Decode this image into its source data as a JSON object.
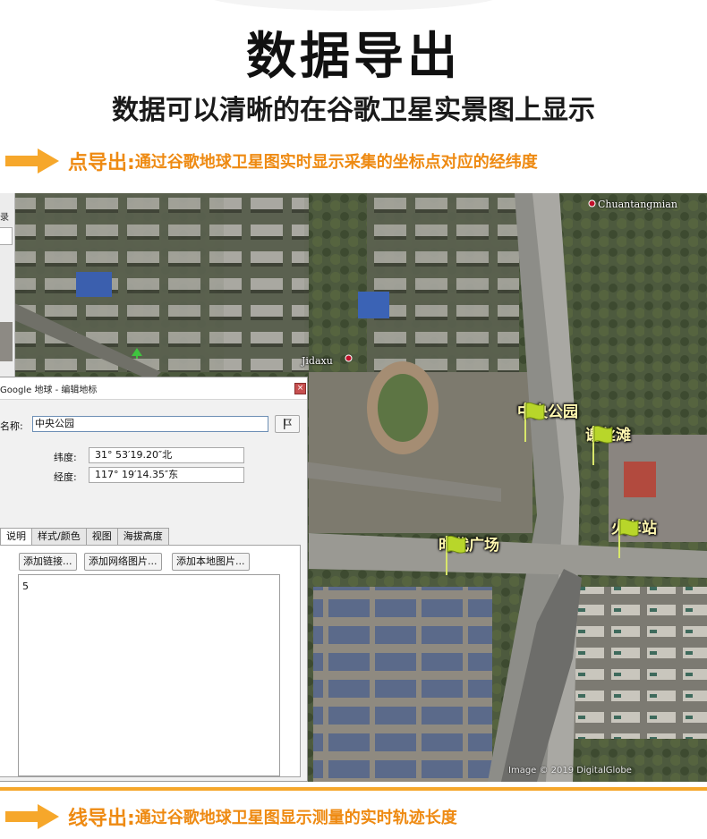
{
  "header": {
    "title": "数据导出",
    "subtitle": "数据可以清晰的在谷歌卫星实景图上显示"
  },
  "features": {
    "point": {
      "label": "点导出:",
      "description": "通过谷歌地球卫星图实时显示采集的坐标点对应的经纬度"
    },
    "line": {
      "label": "线导出:",
      "description": "通过谷歌地球卫星图显示测量的实时轨迹长度"
    }
  },
  "map": {
    "labels": {
      "chuantangmian": "Chuantangmian",
      "jidaxu": "Jidaxu"
    },
    "placemarks": [
      "中央公园",
      "谢丝滩",
      "时代广场",
      "火车站"
    ],
    "copyright": "Image © 2019 DigitalGlobe"
  },
  "left_panel": {
    "text": "录"
  },
  "dialog": {
    "title": "Google 地球 - 编辑地标",
    "close_label": "×",
    "name_label": "名称:",
    "name_value": "中央公园",
    "latitude_label": "纬度:",
    "latitude_value": "31° 53′19.20″北",
    "longitude_label": "经度:",
    "longitude_value": "117° 19′14.35″东",
    "tabs": [
      "说明",
      "样式/颜色",
      "视图",
      "海拔高度"
    ],
    "buttons": [
      "添加链接...",
      "添加网络图片...",
      "添加本地图片..."
    ],
    "description_text": "5"
  },
  "colors": {
    "accent_orange": "#ee8a12",
    "arrow_orange": "#f6a72b",
    "placemark_flag": "#b8d62a"
  },
  "icons": [
    "arrow-right-icon",
    "placemark-flag-icon",
    "placemark-pin-icon",
    "close-icon"
  ]
}
